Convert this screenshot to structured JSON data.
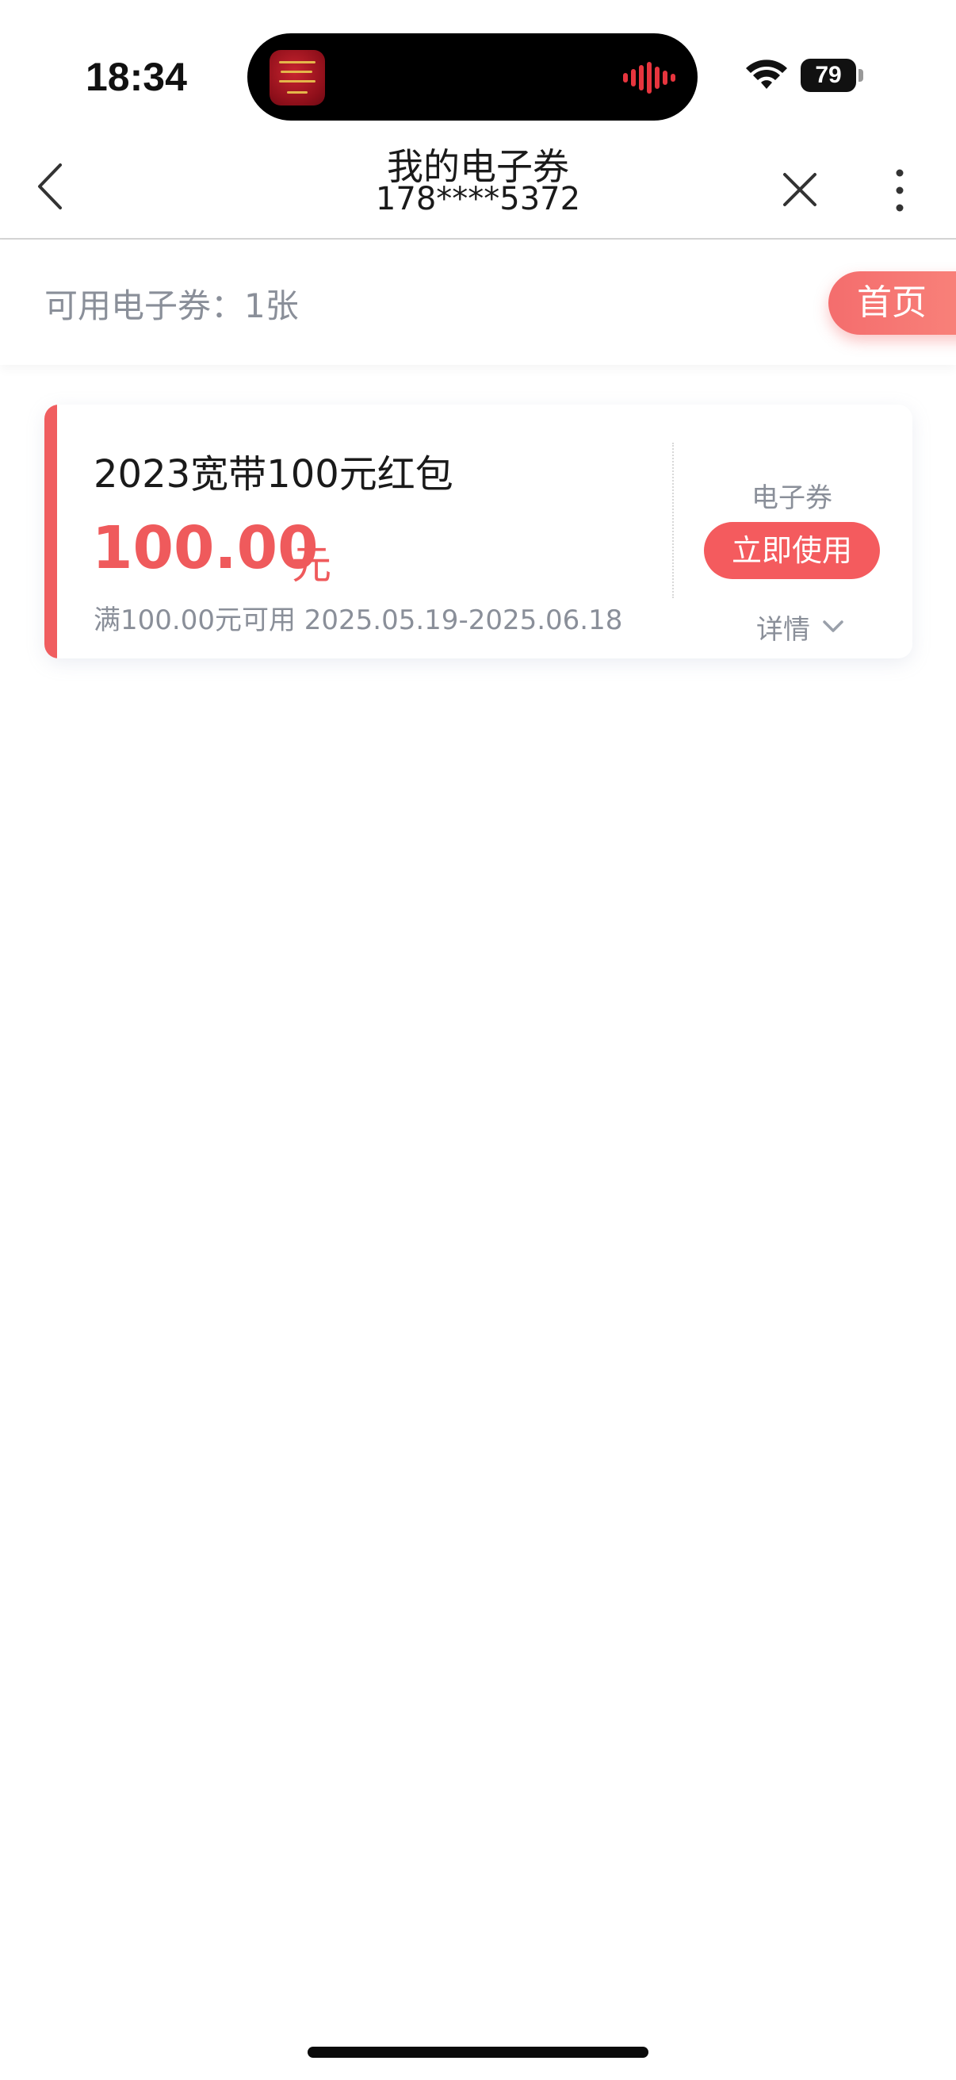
{
  "status_bar": {
    "time": "18:34",
    "battery": "79",
    "icons": [
      "wifi-icon",
      "battery-icon",
      "audio-wave-icon"
    ]
  },
  "nav": {
    "title": "我的电子券",
    "subtitle": "178****5372",
    "icons": [
      "back-icon",
      "close-icon",
      "more-icon"
    ]
  },
  "summary": {
    "available_text": "可用电子券：1张",
    "home_button": "首页"
  },
  "coupon": {
    "title": "2023宽带100元红包",
    "amount": "100.00",
    "unit": "元",
    "condition": "满100.00元可用 2025.05.19-2025.06.18",
    "type": "电子券",
    "use_button": "立即使用",
    "detail": "详情"
  },
  "colors": {
    "accent": "#ef5a5c",
    "muted_text": "#8a8f99"
  }
}
